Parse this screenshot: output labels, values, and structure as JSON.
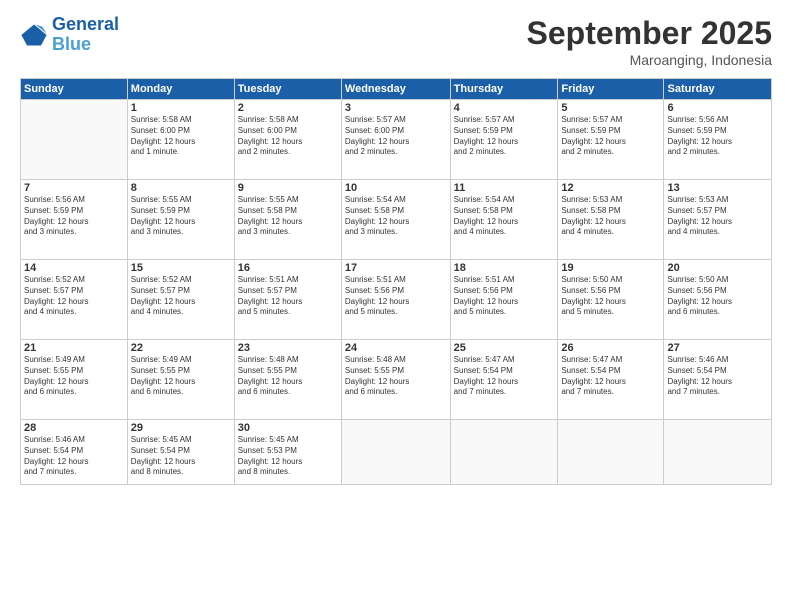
{
  "header": {
    "logo_line1": "General",
    "logo_line2": "Blue",
    "month": "September 2025",
    "location": "Maroanging, Indonesia"
  },
  "days_of_week": [
    "Sunday",
    "Monday",
    "Tuesday",
    "Wednesday",
    "Thursday",
    "Friday",
    "Saturday"
  ],
  "weeks": [
    [
      {
        "day": "",
        "info": ""
      },
      {
        "day": "1",
        "info": "Sunrise: 5:58 AM\nSunset: 6:00 PM\nDaylight: 12 hours\nand 1 minute."
      },
      {
        "day": "2",
        "info": "Sunrise: 5:58 AM\nSunset: 6:00 PM\nDaylight: 12 hours\nand 2 minutes."
      },
      {
        "day": "3",
        "info": "Sunrise: 5:57 AM\nSunset: 6:00 PM\nDaylight: 12 hours\nand 2 minutes."
      },
      {
        "day": "4",
        "info": "Sunrise: 5:57 AM\nSunset: 5:59 PM\nDaylight: 12 hours\nand 2 minutes."
      },
      {
        "day": "5",
        "info": "Sunrise: 5:57 AM\nSunset: 5:59 PM\nDaylight: 12 hours\nand 2 minutes."
      },
      {
        "day": "6",
        "info": "Sunrise: 5:56 AM\nSunset: 5:59 PM\nDaylight: 12 hours\nand 2 minutes."
      }
    ],
    [
      {
        "day": "7",
        "info": "Sunrise: 5:56 AM\nSunset: 5:59 PM\nDaylight: 12 hours\nand 3 minutes."
      },
      {
        "day": "8",
        "info": "Sunrise: 5:55 AM\nSunset: 5:59 PM\nDaylight: 12 hours\nand 3 minutes."
      },
      {
        "day": "9",
        "info": "Sunrise: 5:55 AM\nSunset: 5:58 PM\nDaylight: 12 hours\nand 3 minutes."
      },
      {
        "day": "10",
        "info": "Sunrise: 5:54 AM\nSunset: 5:58 PM\nDaylight: 12 hours\nand 3 minutes."
      },
      {
        "day": "11",
        "info": "Sunrise: 5:54 AM\nSunset: 5:58 PM\nDaylight: 12 hours\nand 4 minutes."
      },
      {
        "day": "12",
        "info": "Sunrise: 5:53 AM\nSunset: 5:58 PM\nDaylight: 12 hours\nand 4 minutes."
      },
      {
        "day": "13",
        "info": "Sunrise: 5:53 AM\nSunset: 5:57 PM\nDaylight: 12 hours\nand 4 minutes."
      }
    ],
    [
      {
        "day": "14",
        "info": "Sunrise: 5:52 AM\nSunset: 5:57 PM\nDaylight: 12 hours\nand 4 minutes."
      },
      {
        "day": "15",
        "info": "Sunrise: 5:52 AM\nSunset: 5:57 PM\nDaylight: 12 hours\nand 4 minutes."
      },
      {
        "day": "16",
        "info": "Sunrise: 5:51 AM\nSunset: 5:57 PM\nDaylight: 12 hours\nand 5 minutes."
      },
      {
        "day": "17",
        "info": "Sunrise: 5:51 AM\nSunset: 5:56 PM\nDaylight: 12 hours\nand 5 minutes."
      },
      {
        "day": "18",
        "info": "Sunrise: 5:51 AM\nSunset: 5:56 PM\nDaylight: 12 hours\nand 5 minutes."
      },
      {
        "day": "19",
        "info": "Sunrise: 5:50 AM\nSunset: 5:56 PM\nDaylight: 12 hours\nand 5 minutes."
      },
      {
        "day": "20",
        "info": "Sunrise: 5:50 AM\nSunset: 5:56 PM\nDaylight: 12 hours\nand 6 minutes."
      }
    ],
    [
      {
        "day": "21",
        "info": "Sunrise: 5:49 AM\nSunset: 5:55 PM\nDaylight: 12 hours\nand 6 minutes."
      },
      {
        "day": "22",
        "info": "Sunrise: 5:49 AM\nSunset: 5:55 PM\nDaylight: 12 hours\nand 6 minutes."
      },
      {
        "day": "23",
        "info": "Sunrise: 5:48 AM\nSunset: 5:55 PM\nDaylight: 12 hours\nand 6 minutes."
      },
      {
        "day": "24",
        "info": "Sunrise: 5:48 AM\nSunset: 5:55 PM\nDaylight: 12 hours\nand 6 minutes."
      },
      {
        "day": "25",
        "info": "Sunrise: 5:47 AM\nSunset: 5:54 PM\nDaylight: 12 hours\nand 7 minutes."
      },
      {
        "day": "26",
        "info": "Sunrise: 5:47 AM\nSunset: 5:54 PM\nDaylight: 12 hours\nand 7 minutes."
      },
      {
        "day": "27",
        "info": "Sunrise: 5:46 AM\nSunset: 5:54 PM\nDaylight: 12 hours\nand 7 minutes."
      }
    ],
    [
      {
        "day": "28",
        "info": "Sunrise: 5:46 AM\nSunset: 5:54 PM\nDaylight: 12 hours\nand 7 minutes."
      },
      {
        "day": "29",
        "info": "Sunrise: 5:45 AM\nSunset: 5:54 PM\nDaylight: 12 hours\nand 8 minutes."
      },
      {
        "day": "30",
        "info": "Sunrise: 5:45 AM\nSunset: 5:53 PM\nDaylight: 12 hours\nand 8 minutes."
      },
      {
        "day": "",
        "info": ""
      },
      {
        "day": "",
        "info": ""
      },
      {
        "day": "",
        "info": ""
      },
      {
        "day": "",
        "info": ""
      }
    ]
  ]
}
